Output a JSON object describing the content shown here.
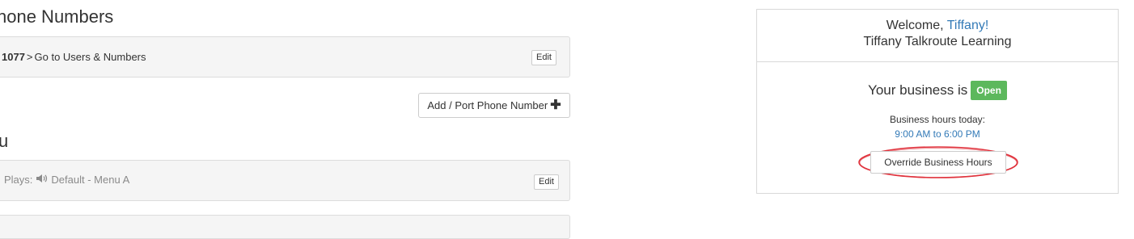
{
  "phone_section": {
    "heading": "hone Numbers",
    "number_fragment": "1077",
    "chevron": ">",
    "goto_link": "Go to Users & Numbers",
    "edit_label": "Edit",
    "add_button_label": "Add / Port Phone Number",
    "add_icon": "plus-icon"
  },
  "menu_section": {
    "heading": "u",
    "plays_label": "Plays:",
    "speaker_icon": "speaker-icon",
    "menu_name": "Default - Menu A",
    "edit_label": "Edit"
  },
  "business_card": {
    "welcome_prefix": "Welcome,",
    "user_name": "Tiffany!",
    "business_name": "Tiffany Talkroute Learning",
    "status_prefix": "Your business is",
    "status_badge": "Open",
    "hours_label": "Business hours today:",
    "hours_value": "9:00 AM to 6:00 PM",
    "override_button": "Override Business Hours",
    "colors": {
      "link": "#337ab7",
      "open_badge": "#5cb85c",
      "annotation": "#e0323c"
    }
  }
}
